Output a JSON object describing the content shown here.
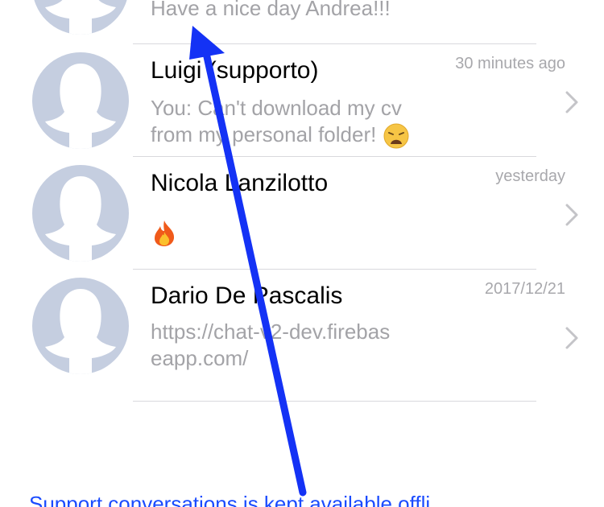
{
  "conversations": [
    {
      "name": "",
      "preview": "Have a nice day Andrea!!!",
      "time": ""
    },
    {
      "name": "Luigi (supporto)",
      "preview": "You: Can't download my cv from my personal folder!",
      "preview_emoji": "weary-face-emoji",
      "time": "30 minutes ago"
    },
    {
      "name": "Nicola Lanzilotto",
      "preview": "",
      "preview_emoji": "fire-emoji",
      "time": "yesterday"
    },
    {
      "name": "Dario De Pascalis",
      "preview": "https://chat-v2-dev.firebaseapp.com/",
      "time": "2017/12/21"
    }
  ],
  "footer": {
    "link_text": "Support conversations is kept available offli"
  },
  "colors": {
    "avatar_bg": "#c5cee0",
    "avatar_silhouette": "#ffffff",
    "text_primary": "#000000",
    "text_secondary": "#a3a3a7",
    "separator": "#d9d9dd",
    "link": "#1a4bff",
    "annotation_arrow": "#1432f5"
  },
  "icons": {
    "avatar": "default-user-avatar-icon",
    "chevron": "chevron-right-icon"
  }
}
